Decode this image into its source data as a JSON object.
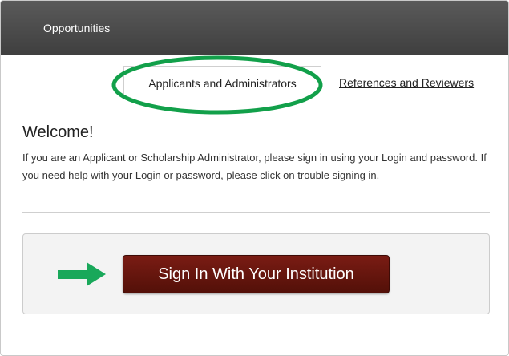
{
  "header": {
    "title": "Opportunities"
  },
  "tabs": [
    {
      "label": "Applicants and Administrators",
      "active": true
    },
    {
      "label": "References and Reviewers",
      "active": false
    }
  ],
  "content": {
    "heading": "Welcome!",
    "description_prefix": "If you are an Applicant or Scholarship Administrator, please sign in using your Login and password. If you need help with your Login or password, please click on ",
    "trouble_link": "trouble signing in",
    "description_suffix": "."
  },
  "signin": {
    "button_label": "Sign In With Your Institution"
  },
  "annotations": {
    "ellipse_color": "#12a04a",
    "arrow_color": "#19a85a"
  },
  "colors": {
    "topbar": "#4a4a4a",
    "button": "#6b1810"
  }
}
